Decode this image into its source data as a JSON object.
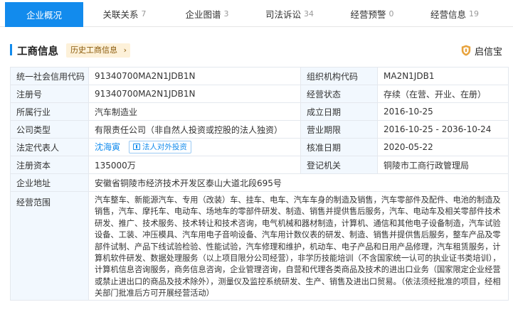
{
  "tabs": [
    {
      "label": "企业概况",
      "count": "",
      "active": true
    },
    {
      "label": "关联关系",
      "count": "7"
    },
    {
      "label": "企业图谱",
      "count": "3"
    },
    {
      "label": "司法诉讼",
      "count": "34"
    },
    {
      "label": "经营预警",
      "count": "0"
    },
    {
      "label": "经营信息",
      "count": "19"
    }
  ],
  "section": {
    "title": "工商信息",
    "history_label": "历史工商信息",
    "brand": "启信宝",
    "accent": "#128bed"
  },
  "info": {
    "credit_code_label": "统一社会信用代码",
    "credit_code": "91340700MA2N1JDB1N",
    "org_code_label": "组织机构代码",
    "org_code": "MA2N1JDB1",
    "reg_no_label": "注册号",
    "reg_no": "91340700MA2N1JDB1N",
    "status_label": "经营状态",
    "status": "存续（在营、开业、在册）",
    "industry_label": "所属行业",
    "industry": "汽车制造业",
    "founded_label": "成立日期",
    "founded": "2016-10-25",
    "type_label": "公司类型",
    "type": "有限责任公司（非自然人投资或控股的法人独资）",
    "term_label": "营业期限",
    "term": "2016-10-25 - 2036-10-24",
    "legal_rep_label": "法定代表人",
    "legal_rep": "沈海寅",
    "invest_label": "法人对外投资",
    "approval_label": "核准日期",
    "approval": "2020-05-22",
    "capital_label": "注册资本",
    "capital": "135000万",
    "authority_label": "登记机关",
    "authority": "铜陵市工商行政管理局",
    "address_label": "企业地址",
    "address": "安徽省铜陵市经济技术开发区泰山大道北段695号",
    "scope_label": "经营范围",
    "scope": "汽车整车、新能源汽车、专用（改装）车、挂车、电车、汽车车身的制造及销售，汽车零部件及配件、电池的制造及销售，汽车、摩托车、电动车、场地车的零部件研发、制造、销售并提供售后服务，汽车、电动车及相关零部件技术研发、推广、技术服务、技术转让和技术咨询，电气机械和器材制造，计算机、通信和其他电子设备制造，汽车试验设备、工装、冲压模具、汽车用电子音响设备、汽车用计数仪表的研发、制造、销售并提供售后服务，整车产品及零部件试制、产品下线试验检验、性能试验，汽车修理和维护，机动车、电子产品和日用产品修理，汽车租赁服务，计算机软件研发、数据处理服务（以上项目限分公司经营），非学历技能培训（不含国家统一认可的执业证书类培训），计算机信息咨询服务，商务信息咨询，企业管理咨询，自营和代理各类商品及技术的进出口业务（国家限定企业经营或禁止进出口的商品及技术除外），测量仪及监控系统研发、生产、销售及进出口贸易。（依法须经批准的项目，经相关部门批准后方可开展经营活动）"
  }
}
